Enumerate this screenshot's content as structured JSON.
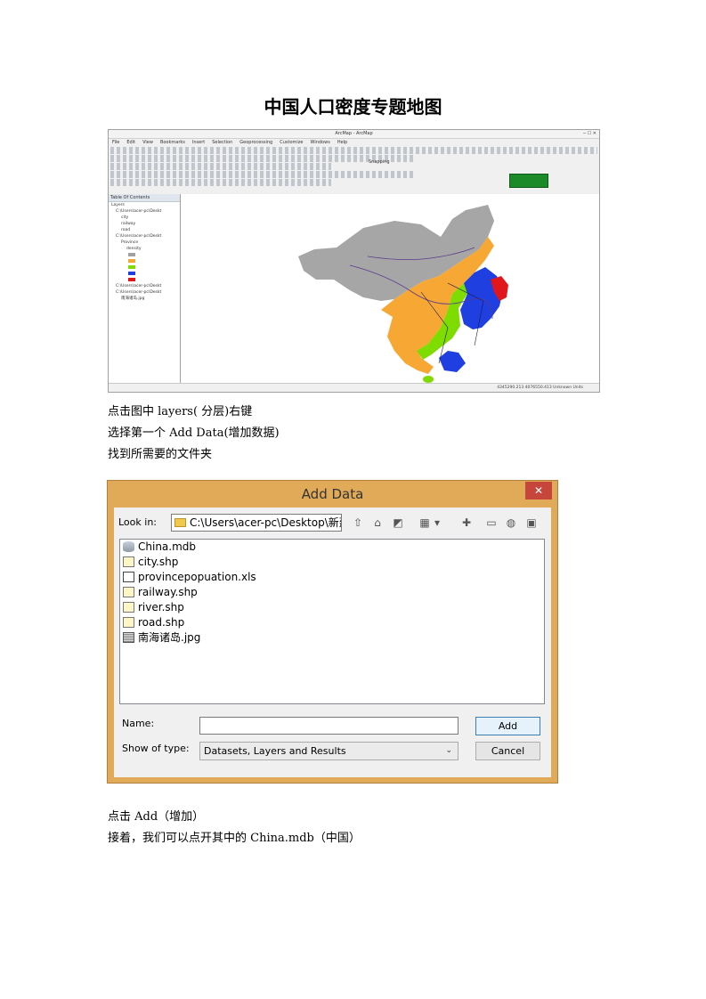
{
  "title": "中国人口密度专题地图",
  "instructions": [
    "点击图中 layers( 分层)右键",
    "选择第一个 Add Data(增加数据)",
    "找到所需要的文件夹"
  ],
  "after": [
    "点击 Add（增加）",
    "接着，我们可以点开其中的 China.mdb（中国）"
  ],
  "arcmap": {
    "window_title": "ArcMap - ArcMap",
    "menu": [
      "File",
      "Edit",
      "View",
      "Bookmarks",
      "Insert",
      "Selection",
      "Geoprocessing",
      "Customize",
      "Windows",
      "Help"
    ],
    "snapping_label": "Snapping",
    "toc_title": "Table Of Contents",
    "toc_items": [
      "Layers",
      "C:\\Users\\acer-pc\\Deskt",
      "city",
      "railway",
      "road",
      "C:\\Users\\acer-pc\\Deskt",
      "Province",
      "density",
      "C:\\Users\\acer-pc\\Deskt",
      "C:\\Users\\acer-pc\\Deskt",
      "南海诸岛.jpg"
    ],
    "legend_colors": [
      "#a0a0a0",
      "#f7a734",
      "#7fdc00",
      "#1f3fe0",
      "#e0161b"
    ],
    "coords": "4345290.213  4076550.413 Unknown Units"
  },
  "dialog": {
    "title": "Add Data",
    "look_in_label": "Look in:",
    "look_in_value": "C:\\Users\\acer-pc\\Desktop\\新建",
    "files": [
      {
        "name": "China.mdb",
        "icon": "database-icon"
      },
      {
        "name": "city.shp",
        "icon": "point-shapefile-icon"
      },
      {
        "name": "provincepopuation.xls",
        "icon": "table-icon"
      },
      {
        "name": "railway.shp",
        "icon": "line-shapefile-icon"
      },
      {
        "name": "river.shp",
        "icon": "line-shapefile-icon"
      },
      {
        "name": "road.shp",
        "icon": "line-shapefile-icon"
      },
      {
        "name": "南海诸岛.jpg",
        "icon": "raster-icon"
      }
    ],
    "name_label": "Name:",
    "name_value": "",
    "type_label": "Show of type:",
    "type_value": "Datasets, Layers and Results",
    "add_button": "Add",
    "cancel_button": "Cancel"
  }
}
